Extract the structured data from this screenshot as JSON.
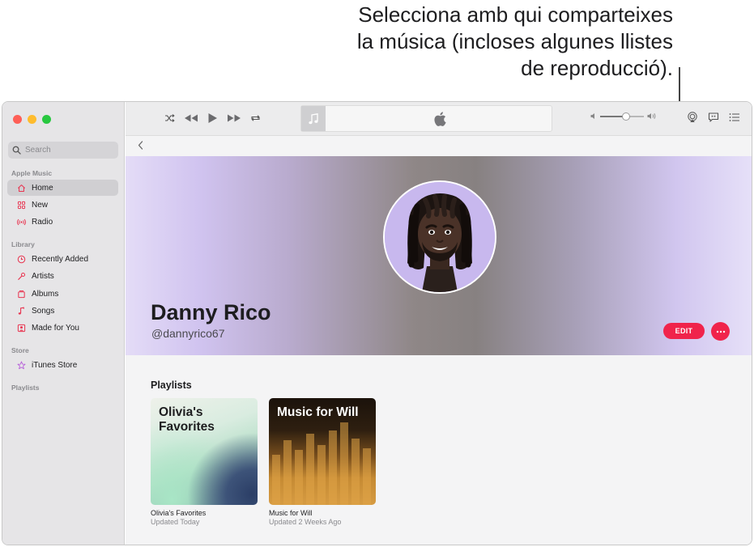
{
  "callout": {
    "line1": "Selecciona amb qui comparteixes",
    "line2": "la música (incloses algunes llistes",
    "line3": "de reproducció)."
  },
  "sidebar": {
    "search_placeholder": "Search",
    "sections": {
      "apple_music": "Apple Music",
      "library": "Library",
      "store": "Store",
      "playlists": "Playlists"
    },
    "items": {
      "home": "Home",
      "new": "New",
      "radio": "Radio",
      "recently_added": "Recently Added",
      "artists": "Artists",
      "albums": "Albums",
      "songs": "Songs",
      "made_for_you": "Made for You",
      "itunes_store": "iTunes Store"
    }
  },
  "toolbar": {
    "volume_level": 0.6
  },
  "profile": {
    "name": "Danny Rico",
    "handle": "@dannyrico67",
    "edit_label": "EDIT",
    "more_label": "···"
  },
  "playlists_section": {
    "title": "Playlists",
    "items": [
      {
        "cover_text_1": "Olivia's",
        "cover_text_2": "Favorites",
        "title": "Olivia's Favorites",
        "subtitle": "Updated Today"
      },
      {
        "cover_text_1": "Music for Will",
        "title": "Music for Will",
        "subtitle": "Updated 2 Weeks Ago"
      }
    ]
  },
  "colors": {
    "accent": "#f0234b",
    "sidebar_icon": "#e8334f"
  }
}
